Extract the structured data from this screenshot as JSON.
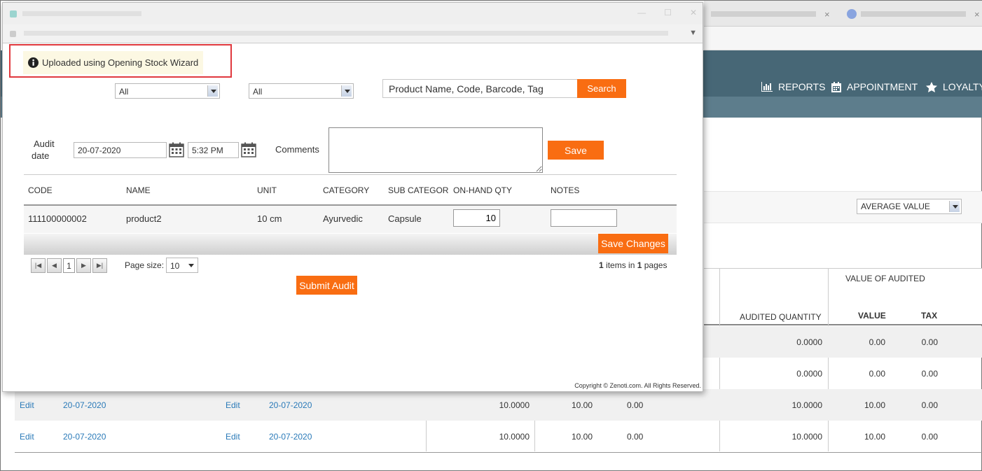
{
  "background": {
    "nav": [
      {
        "icon": "bar-chart-icon",
        "label": "REPORTS"
      },
      {
        "icon": "calendar-icon",
        "label": "APPOINTMENT"
      },
      {
        "icon": "star-icon",
        "label": "LOYALTY"
      }
    ],
    "value_select": "AVERAGE VALUE",
    "table": {
      "group_header": "VALUE OF AUDITED",
      "col_audited_qty": "AUDITED QUANTITY",
      "col_value": "VALUE",
      "col_tax": "TAX",
      "rows": [
        {
          "audited_qty": "0.0000",
          "value": "0.00",
          "tax": "0.00"
        },
        {
          "audited_qty": "0.0000",
          "value": "0.00",
          "tax": "0.00"
        },
        {
          "edit1": "Edit",
          "date1": "20-07-2020",
          "edit2": "Edit",
          "date2": "20-07-2020",
          "qty": "10.0000",
          "val": "10.00",
          "tx": "0.00",
          "audited_qty": "10.0000",
          "value": "10.00",
          "tax": "0.00"
        },
        {
          "edit1": "Edit",
          "date1": "20-07-2020",
          "edit2": "Edit",
          "date2": "20-07-2020",
          "qty": "10.0000",
          "val": "10.00",
          "tx": "0.00",
          "audited_qty": "10.0000",
          "value": "10.00",
          "tax": "0.00"
        }
      ]
    }
  },
  "modal": {
    "notice": "Uploaded using Opening Stock Wizard",
    "filter1": "All",
    "filter2": "All",
    "search_placeholder": "Product Name, Code, Barcode, Tag",
    "search_button": "Search",
    "audit_date_label_1": "Audit",
    "audit_date_label_2": "date",
    "audit_date": "20-07-2020",
    "audit_time": "5:32 PM",
    "comments_label": "Comments",
    "save_button": "Save",
    "columns": {
      "code": "CODE",
      "name": "NAME",
      "unit": "UNIT",
      "category": "CATEGORY",
      "sub_category": "SUB CATEGOR",
      "on_hand_qty": "ON-HAND QTY",
      "notes": "NOTES"
    },
    "row": {
      "code": "111100000002",
      "name": "product2",
      "unit": "10 cm",
      "category": "Ayurvedic",
      "sub_category": "Capsule",
      "on_hand_qty": "10"
    },
    "save_changes_button": "Save Changes",
    "pager": {
      "current_page": "1",
      "page_size_label": "Page size:",
      "page_size": "10",
      "items_count": "1",
      "items_text_1": "items in",
      "pages_count": "1",
      "items_text_2": "pages"
    },
    "submit_button": "Submit Audit",
    "copyright": "Copyright © Zenoti.com. All Rights Reserved."
  },
  "colors": {
    "accent": "#f96d12",
    "header": "#476776",
    "link": "#2a7ab8",
    "notice_bg": "#fcf8e3",
    "highlight": "#e0383e"
  }
}
